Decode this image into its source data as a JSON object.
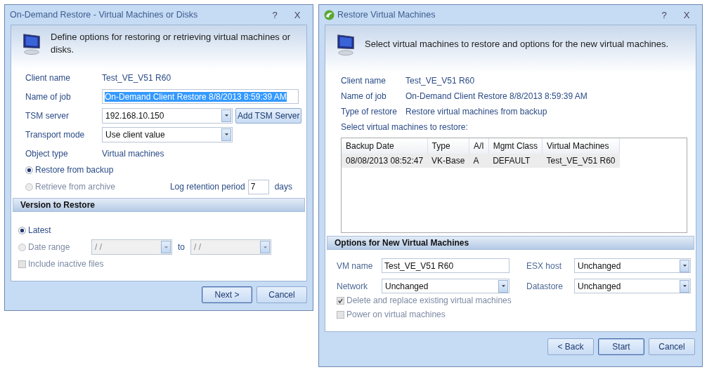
{
  "left_window": {
    "title": "On-Demand Restore - Virtual Machines or Disks",
    "help": "?",
    "close": "X",
    "header": "Define options for restoring or retrieving virtual machines or disks.",
    "rows": [
      {
        "kind": "text",
        "label": "Client name",
        "value": "Test_VE_V51 R60"
      },
      {
        "kind": "input",
        "label": "Name of job",
        "value": "On-Demand Client Restore 8/8/2013 8:59:39 AM",
        "selected": true
      },
      {
        "kind": "combo",
        "label": "TSM server",
        "value": "192.168.10.150",
        "button": "Add TSM Server"
      },
      {
        "kind": "combo",
        "label": "Transport mode",
        "value": "Use client value"
      },
      {
        "kind": "text",
        "label": "Object type",
        "value": "Virtual machines"
      }
    ],
    "source_options": [
      {
        "label": "Restore from backup",
        "selected": true,
        "disabled": false
      },
      {
        "label": "Retrieve from archive",
        "selected": false,
        "disabled": true
      }
    ],
    "log_retention": {
      "label": "Log retention period",
      "value": "7",
      "unit": "days"
    },
    "section": "Version to Restore",
    "version_options": [
      {
        "label": "Latest",
        "selected": true,
        "disabled": false
      },
      {
        "label": "Date range",
        "selected": false,
        "disabled": true
      }
    ],
    "date_from": "/ /",
    "date_to_label": "to",
    "date_to": "/ /",
    "include_inactive": {
      "label": "Include inactive files",
      "checked": false,
      "disabled": true
    },
    "buttons": [
      {
        "label": "Next >",
        "default": true
      },
      {
        "label": "Cancel",
        "default": false
      }
    ]
  },
  "right_window": {
    "title": "Restore Virtual Machines",
    "help": "?",
    "close": "X",
    "header": "Select virtual machines to restore and options for the new virtual machines.",
    "info": [
      {
        "label": "Client name",
        "value": "Test_VE_V51 R60"
      },
      {
        "label": "Name of job",
        "value": "On-Demand Client Restore 8/8/2013 8:59:39 AM"
      },
      {
        "label": "Type of restore",
        "value": "Restore virtual machines from backup"
      }
    ],
    "table_caption": "Select virtual machines to restore:",
    "table": {
      "columns": [
        "Backup Date",
        "Type",
        "A/I",
        "Mgmt Class",
        "Virtual Machines"
      ],
      "rows": [
        {
          "cells": [
            "08/08/2013 08:52:47",
            "VK-Base",
            "A",
            "DEFAULT",
            "Test_VE_V51 R60"
          ],
          "selected": true
        }
      ]
    },
    "section": "Options for New Virtual Machines",
    "options": [
      {
        "kind": "input",
        "label": "VM name",
        "value": "Test_VE_V51 R60"
      },
      {
        "kind": "combo",
        "label": "ESX host",
        "value": "Unchanged"
      },
      {
        "kind": "combo",
        "label": "Network",
        "value": "Unchanged"
      },
      {
        "kind": "combo",
        "label": "Datastore",
        "value": "Unchanged"
      }
    ],
    "checkboxes": [
      {
        "label": "Delete and replace existing virtual machines",
        "checked": true,
        "disabled": true
      },
      {
        "label": "Power on virtual machines",
        "checked": false,
        "disabled": true
      }
    ],
    "buttons": [
      {
        "label": "< Back",
        "default": false
      },
      {
        "label": "Start",
        "default": true
      },
      {
        "label": "Cancel",
        "default": false
      }
    ]
  }
}
